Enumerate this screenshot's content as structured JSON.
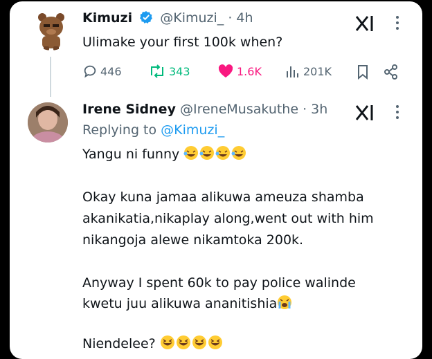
{
  "tweet": {
    "author_name": "Kimuzi",
    "handle": "@Kimuzi_",
    "time": "· 4h",
    "text": "Ulimake your first 100k when?",
    "actions": {
      "replies": "446",
      "retweets": "343",
      "likes": "1.6K",
      "views": "201K"
    }
  },
  "reply": {
    "author_name": "Irene Sidney",
    "handle": "@IreneMusakuthe",
    "time": "· 3h",
    "replying_prefix": "Replying to",
    "replying_to": "@Kimuzi_",
    "lines": [
      "Yangu ni funny",
      "Okay kuna jamaa alikuwa ameuza shamba",
      "akanikatia,nikaplay along,went out with him",
      "nikangoja alewe nikamtoka 200k.",
      "Anyway I spent 60k to pay police walinde",
      "kwetu juu alikuwa ananitishia",
      "Niendelee?"
    ]
  },
  "colors": {
    "accent": "#1d9bf0",
    "retweet": "#00ba7c",
    "like": "#f91880",
    "muted": "#536471"
  },
  "icons": [
    "verified-badge-icon",
    "grok-icon",
    "more-icon",
    "reply-icon",
    "retweet-icon",
    "like-icon",
    "views-icon",
    "bookmark-icon",
    "share-icon",
    "laughing-emoji",
    "crying-emoji",
    "grinning-emoji"
  ]
}
